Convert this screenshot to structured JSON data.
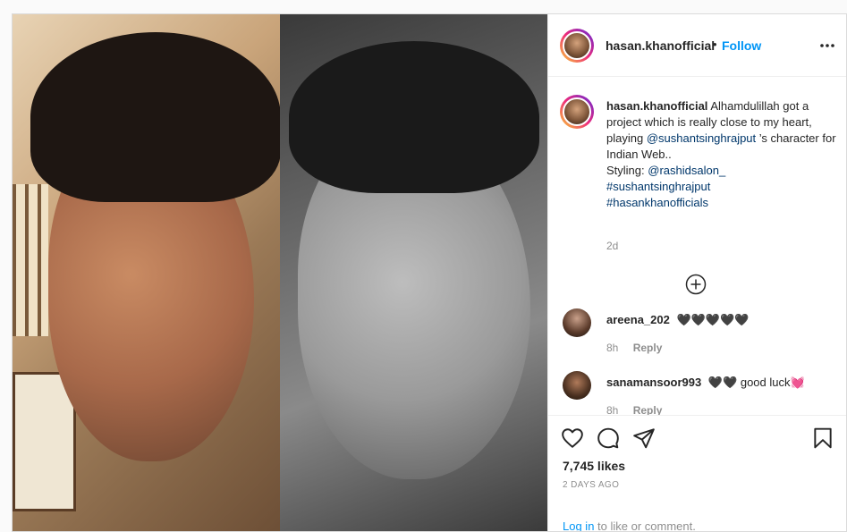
{
  "post": {
    "username": "hasan.khanofficial",
    "follow_dot": "•",
    "follow_label": "Follow",
    "more_icon": "more-horizontal-icon"
  },
  "caption": {
    "username": "hasan.khanofficial",
    "text_1": "Alhamdulillah got a project which is really close to my heart, playing",
    "mention_1": "@sushantsinghrajput",
    "text_2": "’s character for Indian Web..",
    "styling_label": "Styling:",
    "mention_2": "@rashidsalon_",
    "hashtag_1": "#sushantsinghrajput",
    "hashtag_2": "#hasankhanofficials",
    "time": "2d"
  },
  "load_more_icon": "plus-circle-icon",
  "comments": [
    {
      "username": "areena_202",
      "text": "🖤🖤🖤🖤🖤",
      "time": "8h",
      "reply_label": "Reply"
    },
    {
      "username": "sanamansoor993",
      "text": "🖤🖤 good luck💓",
      "time": "8h",
      "reply_label": "Reply"
    }
  ],
  "actions": {
    "like_icon": "heart-icon",
    "comment_icon": "comment-icon",
    "share_icon": "share-icon",
    "save_icon": "bookmark-icon"
  },
  "likes": "7,745 likes",
  "date": "2 DAYS AGO",
  "login": {
    "link": "Log in",
    "text": "to like or comment."
  },
  "colors": {
    "link_blue": "#0095f6",
    "mention_blue": "#00376b",
    "text": "#262626",
    "muted": "#8e8e8e"
  }
}
